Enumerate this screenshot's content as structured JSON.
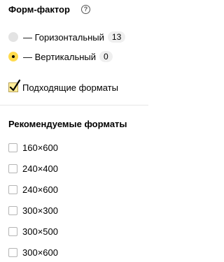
{
  "form_factor": {
    "title": "Форм-фактор",
    "help_symbol": "?",
    "options": [
      {
        "label": "— Горизонтальный",
        "count": "13",
        "selected": false
      },
      {
        "label": "— Вертикальный",
        "count": "0",
        "selected": true
      }
    ]
  },
  "suitable": {
    "label": "Подходящие форматы",
    "checked": true
  },
  "recommended": {
    "title": "Рекомендуемые форматы",
    "formats": [
      "160×600",
      "240×400",
      "240×600",
      "300×300",
      "300×500",
      "300×600"
    ]
  },
  "colors": {
    "accent": "#ffdb4d",
    "checkbox_fill": "#ffec99",
    "badge_bg": "#efefef"
  }
}
